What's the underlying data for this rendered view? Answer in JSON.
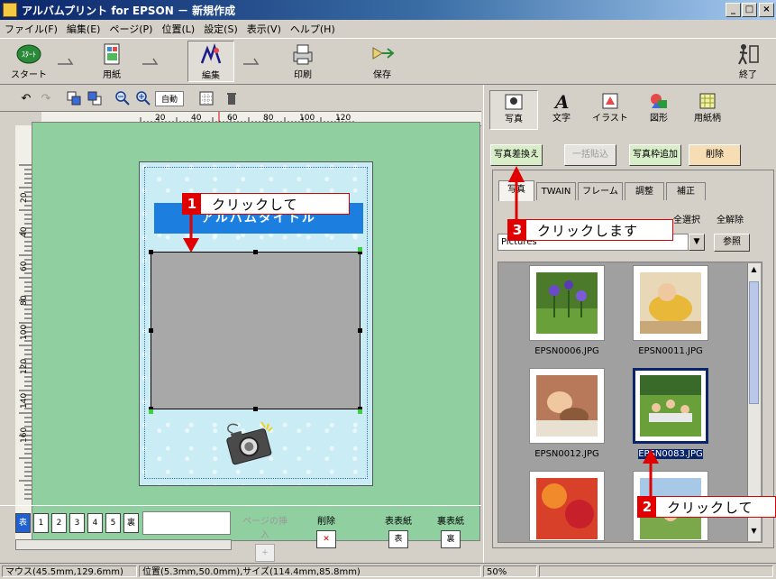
{
  "window": {
    "title": "アルバムプリント for EPSON － 新規作成",
    "controls": [
      "minimize-icon",
      "maximize-icon",
      "close-icon"
    ]
  },
  "menu": [
    "ファイル(F)",
    "編集(E)",
    "ページ(P)",
    "位置(L)",
    "設定(S)",
    "表示(V)",
    "ヘルプ(H)"
  ],
  "main_toolbar": {
    "start": "スタート",
    "paper": "用紙",
    "edit": "編集",
    "print": "印刷",
    "save": "保存",
    "exit": "終了",
    "start_badge": "ｽﾀｰﾄ"
  },
  "edit_toolbar": {
    "fit_button": "自動"
  },
  "ruler": {
    "h_ticks": [
      "20",
      "40",
      "60",
      "80",
      "100",
      "120"
    ],
    "v_ticks": [
      "20",
      "40",
      "60",
      "80",
      "100",
      "120",
      "140",
      "160"
    ]
  },
  "canvas": {
    "album_title": "アルバムタイトル"
  },
  "page_bar": {
    "pages": [
      "表",
      "1",
      "2",
      "3",
      "4",
      "5",
      "裏"
    ],
    "insert_page": "ページの挿入",
    "delete": "削除",
    "front_cover": "表表紙",
    "back_cover": "裏表紙",
    "front_icon": "表",
    "back_icon": "裏"
  },
  "right_panel": {
    "categories": [
      "写真",
      "文字",
      "イラスト",
      "図形",
      "用紙柄"
    ],
    "actions": {
      "replace_photo": "写真差換え",
      "paste_all": "一括貼込",
      "add_frame": "写真枠追加",
      "delete": "削除"
    },
    "tabs": [
      "写真",
      "TWAIN",
      "フレーム",
      "調整",
      "補正"
    ],
    "select_all": "全選択",
    "deselect_all": "全解除",
    "folder": "Pictures",
    "browse": "参照",
    "thumbnails": [
      {
        "name": "EPSN0006.JPG",
        "selected": false
      },
      {
        "name": "EPSN0011.JPG",
        "selected": false
      },
      {
        "name": "EPSN0012.JPG",
        "selected": false
      },
      {
        "name": "EPSN0083.JPG",
        "selected": true
      },
      {
        "name": "",
        "selected": false
      },
      {
        "name": "",
        "selected": false
      }
    ]
  },
  "callouts": [
    {
      "num": "1",
      "text": "クリックして"
    },
    {
      "num": "2",
      "text": "クリックして"
    },
    {
      "num": "3",
      "text": "クリックします"
    }
  ],
  "status": {
    "mouse": "マウス(45.5mm,129.6mm)",
    "position": "位置(5.3mm,50.0mm),サイズ(114.4mm,85.8mm)",
    "zoom": "50%"
  },
  "colors": {
    "title_bar": "#0a246a",
    "canvas_bg": "#8fcfa0",
    "album_title_bg": "#1c7fe0",
    "callout_red": "#e00000",
    "selection": "#0a246a"
  }
}
